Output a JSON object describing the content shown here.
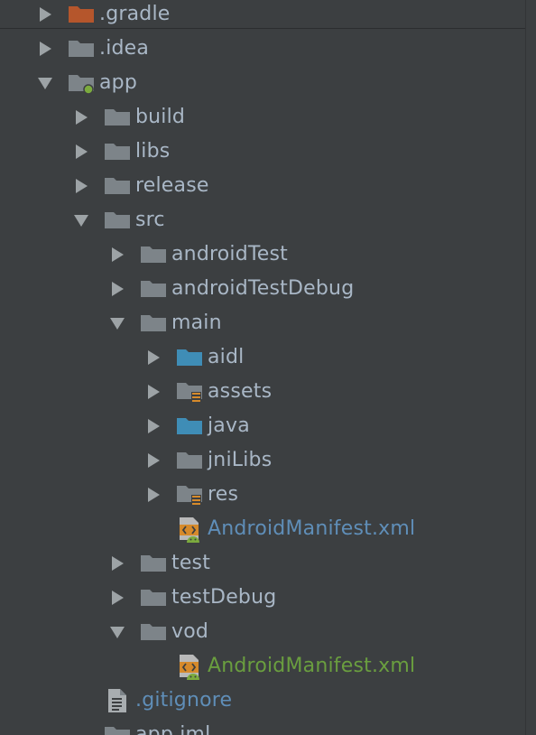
{
  "colors": {
    "background": "#3c3f41",
    "text": "#a9b7c6",
    "folder": "#7d8489",
    "source_folder": "#3f8db6",
    "gradle_folder": "#b5562c",
    "arrow": "#9da3a6",
    "unversioned_file": "#5f8eb8",
    "added_file": "#6a9e3f",
    "manifest_orange": "#d68a2b",
    "android_green": "#7cab3e"
  },
  "items": [
    {
      "label": ".gradle",
      "depth": 0,
      "arrow": "right",
      "icon": "gradle-folder-icon",
      "color": "default"
    },
    {
      "label": ".idea",
      "depth": 0,
      "arrow": "right",
      "icon": "folder-icon",
      "color": "default"
    },
    {
      "label": "app",
      "depth": 0,
      "arrow": "down",
      "icon": "module-folder-icon",
      "color": "default"
    },
    {
      "label": "build",
      "depth": 1,
      "arrow": "right",
      "icon": "folder-icon",
      "color": "default"
    },
    {
      "label": "libs",
      "depth": 1,
      "arrow": "right",
      "icon": "folder-icon",
      "color": "default"
    },
    {
      "label": "release",
      "depth": 1,
      "arrow": "right",
      "icon": "folder-icon",
      "color": "default"
    },
    {
      "label": "src",
      "depth": 1,
      "arrow": "down",
      "icon": "folder-icon",
      "color": "default"
    },
    {
      "label": "androidTest",
      "depth": 2,
      "arrow": "right",
      "icon": "folder-icon",
      "color": "default"
    },
    {
      "label": "androidTestDebug",
      "depth": 2,
      "arrow": "right",
      "icon": "folder-icon",
      "color": "default"
    },
    {
      "label": "main",
      "depth": 2,
      "arrow": "down",
      "icon": "folder-icon",
      "color": "default"
    },
    {
      "label": "aidl",
      "depth": 3,
      "arrow": "right",
      "icon": "source-folder-icon",
      "color": "default"
    },
    {
      "label": "assets",
      "depth": 3,
      "arrow": "right",
      "icon": "resource-folder-icon",
      "color": "default"
    },
    {
      "label": "java",
      "depth": 3,
      "arrow": "right",
      "icon": "source-folder-icon",
      "color": "default"
    },
    {
      "label": "jniLibs",
      "depth": 3,
      "arrow": "right",
      "icon": "folder-icon",
      "color": "default"
    },
    {
      "label": "res",
      "depth": 3,
      "arrow": "right",
      "icon": "resource-folder-icon",
      "color": "default"
    },
    {
      "label": "AndroidManifest.xml",
      "depth": 3,
      "arrow": "none",
      "icon": "android-manifest-icon",
      "color": "blue"
    },
    {
      "label": "test",
      "depth": 2,
      "arrow": "right",
      "icon": "folder-icon",
      "color": "default"
    },
    {
      "label": "testDebug",
      "depth": 2,
      "arrow": "right",
      "icon": "folder-icon",
      "color": "default"
    },
    {
      "label": "vod",
      "depth": 2,
      "arrow": "down",
      "icon": "folder-icon",
      "color": "default"
    },
    {
      "label": "AndroidManifest.xml",
      "depth": 3,
      "arrow": "none",
      "icon": "android-manifest-icon",
      "color": "green"
    },
    {
      "label": ".gitignore",
      "depth": 1,
      "arrow": "none",
      "icon": "text-file-icon",
      "color": "blue"
    },
    {
      "label": "app.iml",
      "depth": 1,
      "arrow": "none",
      "icon": "folder-icon",
      "color": "default"
    }
  ]
}
